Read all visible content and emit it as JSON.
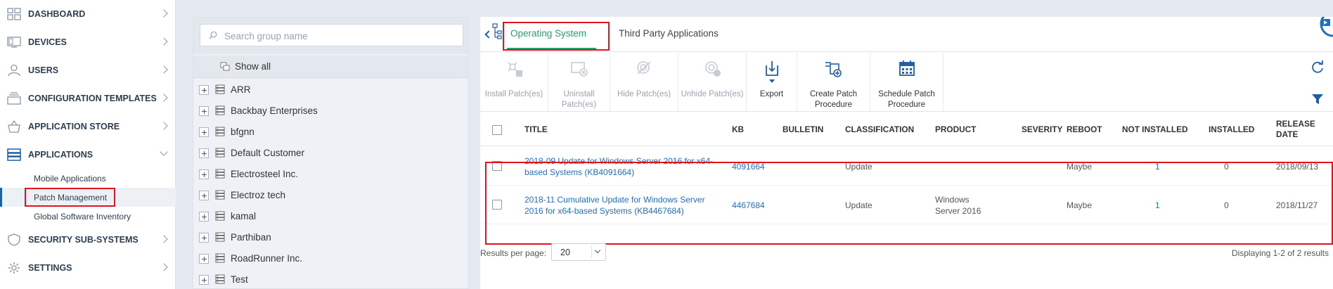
{
  "nav": {
    "items": [
      {
        "label": "DASHBOARD",
        "icon": "grid-icon"
      },
      {
        "label": "DEVICES",
        "icon": "devices-icon"
      },
      {
        "label": "USERS",
        "icon": "user-icon"
      },
      {
        "label": "CONFIGURATION TEMPLATES",
        "icon": "config-templates-icon"
      },
      {
        "label": "APPLICATION STORE",
        "icon": "store-basket-icon"
      },
      {
        "label": "APPLICATIONS",
        "icon": "applications-icon"
      },
      {
        "label": "SECURITY SUB-SYSTEMS",
        "icon": "shield-icon"
      },
      {
        "label": "SETTINGS",
        "icon": "gear-icon"
      }
    ],
    "sub_items": [
      {
        "label": "Mobile Applications"
      },
      {
        "label": "Patch Management"
      },
      {
        "label": "Global Software Inventory"
      }
    ]
  },
  "groups": {
    "search_placeholder": "Search group name",
    "show_all": "Show all",
    "items": [
      "ARR",
      "Backbay Enterprises",
      "bfgnn",
      "Default Customer",
      "Electrosteel Inc.",
      "Electroz tech",
      "kamal",
      "Parthiban",
      "RoadRunner Inc.",
      "Test"
    ]
  },
  "tabs": {
    "os": "Operating System",
    "tpa": "Third Party Applications"
  },
  "toolbar": {
    "install": "Install Patch(es)",
    "uninstall_1": "Uninstall",
    "uninstall_2": "Patch(es)",
    "hide": "Hide Patch(es)",
    "unhide": "Unhide Patch(es)",
    "export": "Export",
    "create_1": "Create Patch",
    "create_2": "Procedure",
    "schedule_1": "Schedule Patch",
    "schedule_2": "Procedure"
  },
  "grid": {
    "headers": {
      "title": "TITLE",
      "kb": "KB",
      "bulletin": "BULLETIN",
      "classification": "CLASSIFICATION",
      "product": "PRODUCT",
      "severity": "SEVERITY",
      "reboot": "REBOOT",
      "not_installed": "NOT INSTALLED",
      "installed": "INSTALLED",
      "release_1": "RELEASE",
      "release_2": "DATE"
    },
    "rows": [
      {
        "title_1": "2018-09 Update for Windows Server 2016 for x64-",
        "title_2": "based Systems (KB4091664)",
        "kb": "4091664",
        "bulletin": "",
        "classification": "Update",
        "product_1": "",
        "product_2": "",
        "severity": "",
        "reboot": "Maybe",
        "not_installed": "1",
        "installed": "0",
        "release_date": "2018/09/13"
      },
      {
        "title_1": "2018-11 Cumulative Update for Windows Server",
        "title_2": "2016 for x64-based Systems (KB4467684)",
        "kb": "4467684",
        "bulletin": "",
        "classification": "Update",
        "product_1": "Windows",
        "product_2": "Server 2016",
        "severity": "",
        "reboot": "Maybe",
        "not_installed": "1",
        "installed": "0",
        "release_date": "2018/11/27"
      }
    ]
  },
  "pager": {
    "results_label": "Results per page:",
    "per_page": "20",
    "display_info": "Displaying 1-2 of 2 results"
  },
  "colors": {
    "accent_green": "#2a9d6b",
    "link_blue": "#1e6fc4",
    "highlight_red": "#e0141e",
    "nav_text": "#2c3e50"
  }
}
